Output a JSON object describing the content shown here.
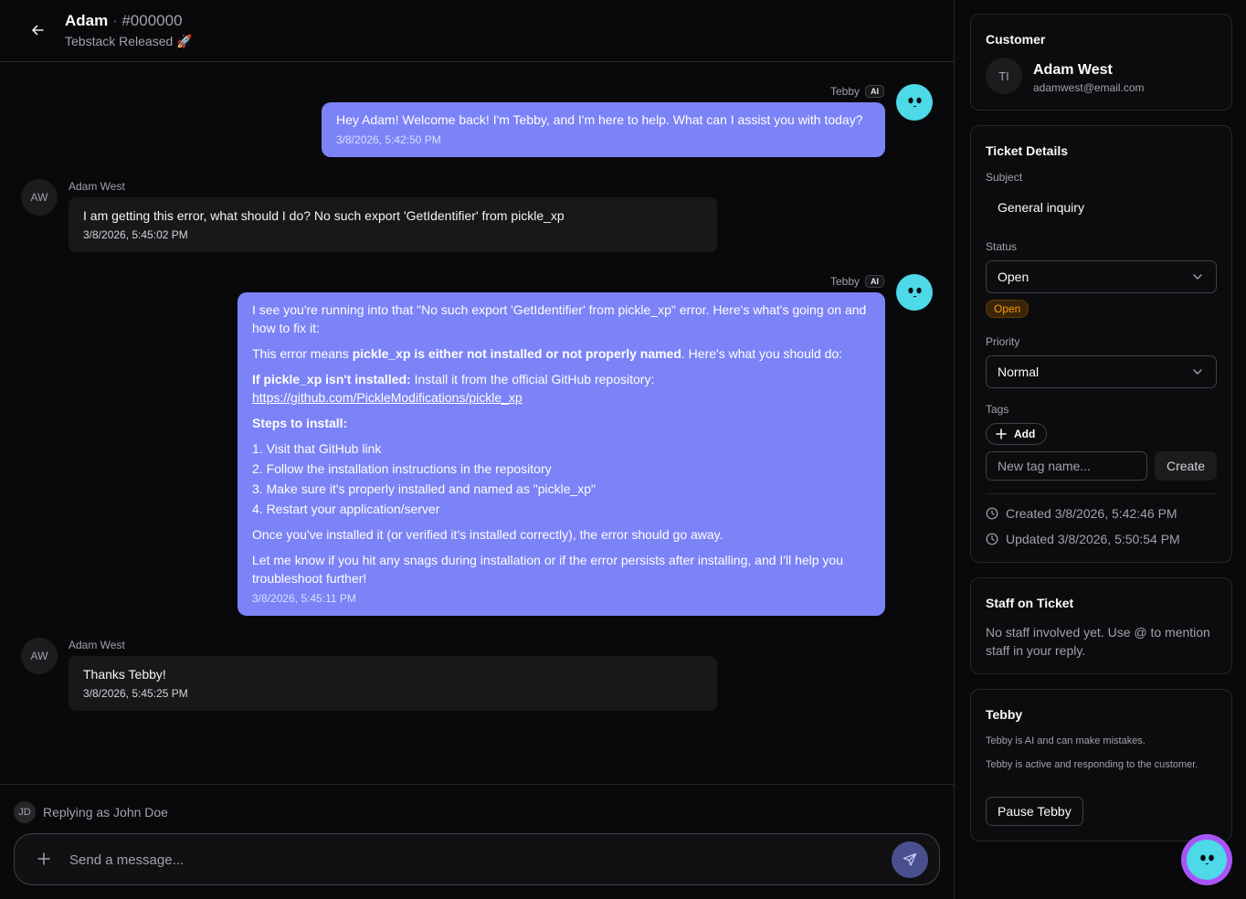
{
  "header": {
    "name": "Adam",
    "separator": " · ",
    "ticket_id": "#000000",
    "subtitle": "Tebstack Released 🚀"
  },
  "messages": [
    {
      "sender": "Tebby",
      "badge": "AI",
      "text": "Hey Adam! Welcome back! I'm Tebby, and I'm here to help. What can I assist you with today?",
      "time": "3/8/2026, 5:42:50 PM"
    },
    {
      "sender": "Adam West",
      "initials": "AW",
      "text": "I am getting this error, what should I do?  No such export 'GetIdentifier' from pickle_xp",
      "time": "3/8/2026, 5:45:02 PM"
    },
    {
      "sender": "Tebby",
      "badge": "AI",
      "p1": "I see you're running into that \"No such export 'GetIdentifier' from pickle_xp\" error. Here's what's going on and how to fix it:",
      "p2_a": "This error means ",
      "p2_b": "pickle_xp is either not installed or not properly named",
      "p2_c": ". Here's what you should do:",
      "p3_a": "If pickle_xp isn't installed:",
      "p3_b": " Install it from the official GitHub repository: ",
      "p3_link": "https://github.com/PickleModifications/pickle_xp",
      "steps_title": "Steps to install:",
      "steps": [
        "1. Visit that GitHub link",
        "2. Follow the installation instructions in the repository",
        "3. Make sure it's properly installed and named as \"pickle_xp\"",
        "4. Restart your application/server"
      ],
      "p4": "Once you've installed it (or verified it's installed correctly), the error should go away.",
      "p5": "Let me know if you hit any snags during installation or if the error persists after installing, and I'll help you troubleshoot further!",
      "time": "3/8/2026, 5:45:11 PM"
    },
    {
      "sender": "Adam West",
      "initials": "AW",
      "text": "Thanks Tebby!",
      "time": "3/8/2026, 5:45:25 PM"
    }
  ],
  "composer": {
    "reply_initials": "JD",
    "reply_as": "Replying as John Doe",
    "placeholder": "Send a message..."
  },
  "customer": {
    "title": "Customer",
    "initials": "TI",
    "name": "Adam West",
    "email": "adamwest@email.com"
  },
  "ticket": {
    "title": "Ticket Details",
    "subject_label": "Subject",
    "subject": "General inquiry",
    "status_label": "Status",
    "status": "Open",
    "status_badge": "Open",
    "priority_label": "Priority",
    "priority": "Normal",
    "tags_label": "Tags",
    "add_label": "Add",
    "tag_placeholder": "New tag name...",
    "create_label": "Create",
    "created": "Created 3/8/2026, 5:42:46 PM",
    "updated": "Updated 3/8/2026, 5:50:54 PM"
  },
  "staff": {
    "title": "Staff on Ticket",
    "text": "No staff involved yet. Use @ to mention staff in your reply."
  },
  "tebby": {
    "title": "Tebby",
    "note": "Tebby is AI and can make mistakes.",
    "status": "Tebby is active and responding to the customer.",
    "pause_label": "Pause Tebby"
  },
  "colors": {
    "accent": "#7b83f7",
    "bot": "#4dd9e8",
    "fab": "#a855f7",
    "status_open": "#f59e0b"
  }
}
